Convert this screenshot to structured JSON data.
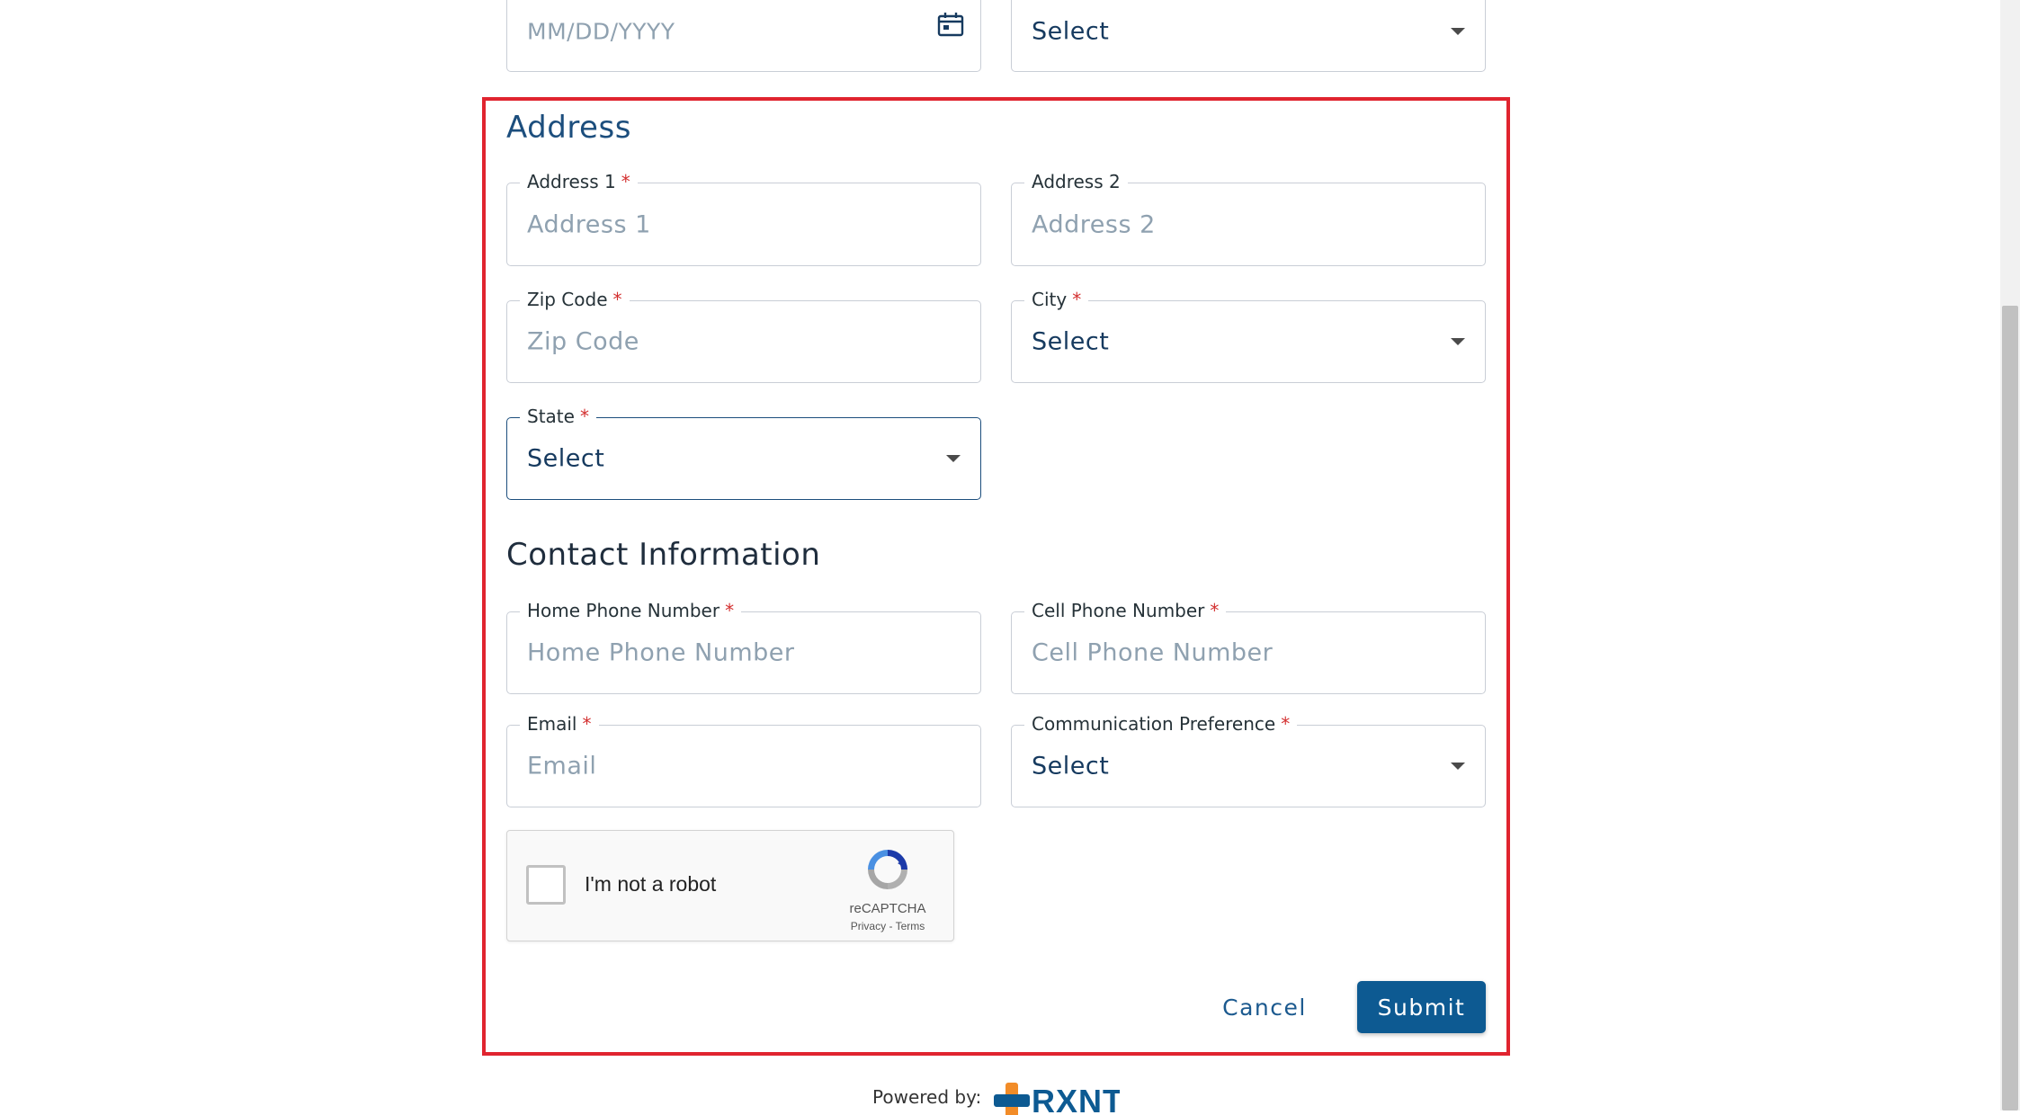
{
  "top_row": {
    "date_field": {
      "placeholder": "MM/DD/YYYY",
      "icon": "calendar-icon"
    },
    "select_field": {
      "value": "Select"
    }
  },
  "address": {
    "title": "Address",
    "address1": {
      "label": "Address 1",
      "required": "*",
      "placeholder": "Address 1"
    },
    "address2": {
      "label": "Address 2",
      "placeholder": "Address 2"
    },
    "zip": {
      "label": "Zip Code",
      "required": "*",
      "placeholder": "Zip Code"
    },
    "city": {
      "label": "City",
      "required": "*",
      "value": "Select"
    },
    "state": {
      "label": "State",
      "required": "*",
      "value": "Select"
    }
  },
  "contact": {
    "title": "Contact Information",
    "home_phone": {
      "label": "Home Phone Number",
      "required": "*",
      "placeholder": "Home Phone Number"
    },
    "cell_phone": {
      "label": "Cell Phone Number",
      "required": "*",
      "placeholder": "Cell Phone Number"
    },
    "email": {
      "label": "Email",
      "required": "*",
      "placeholder": "Email"
    },
    "comm_pref": {
      "label": "Communication Preference",
      "required": "*",
      "value": "Select"
    }
  },
  "recaptcha": {
    "label": "I'm not a robot",
    "brand": "reCAPTCHA",
    "privacy": "Privacy",
    "separator": " - ",
    "terms": "Terms"
  },
  "actions": {
    "cancel": "Cancel",
    "submit": "Submit"
  },
  "footer": {
    "powered_by": "Powered by:",
    "logo_text": "RXNT"
  },
  "colors": {
    "accent": "#0d5a92",
    "highlight_border": "#e0242f",
    "required": "#d32f2f",
    "placeholder": "#8fa1b0"
  }
}
